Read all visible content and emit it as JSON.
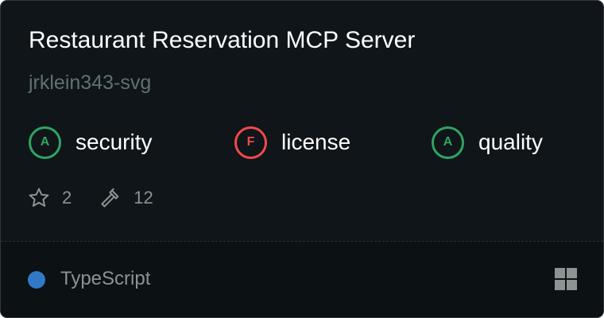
{
  "server": {
    "title": "Restaurant Reservation MCP Server",
    "author": "jrklein343-svg"
  },
  "grades": [
    {
      "grade": "A",
      "label": "security",
      "status": "pass"
    },
    {
      "grade": "F",
      "label": "license",
      "status": "fail"
    },
    {
      "grade": "A",
      "label": "quality",
      "status": "pass"
    }
  ],
  "stats": {
    "stars": "2",
    "star_icon": "star-icon",
    "tools": "12",
    "tool_icon": "hammer-icon"
  },
  "footer": {
    "language": "TypeScript",
    "language_color": "#3178c6",
    "platform_icon": "windows-grid-icon"
  },
  "colors": {
    "pass": "#2ea464",
    "fail": "#f04a4c",
    "background": "#0f1519"
  }
}
